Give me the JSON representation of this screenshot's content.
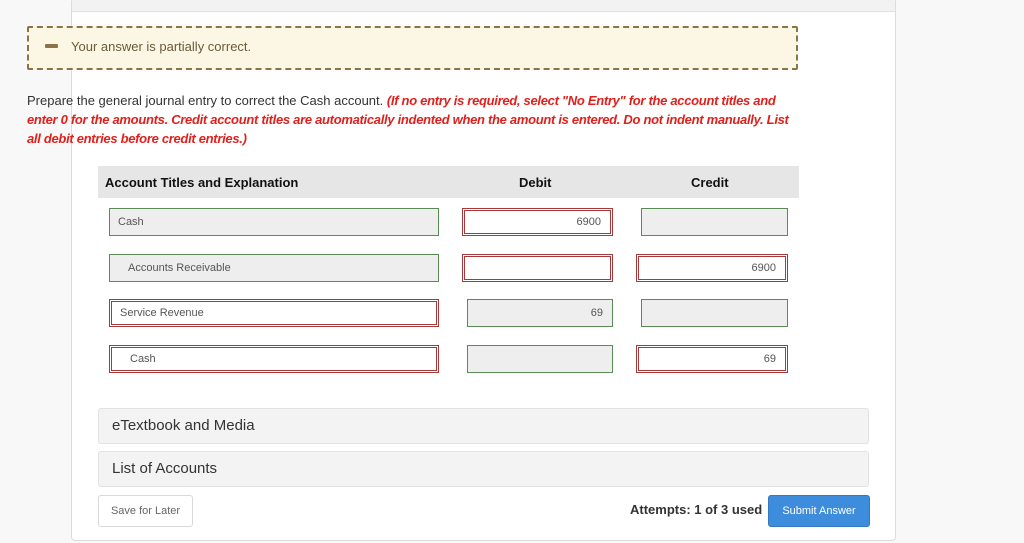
{
  "feedback": {
    "status_icon": "partial-dash-icon",
    "message": "Your answer is partially correct."
  },
  "prompt": {
    "text": "Prepare the general journal entry to correct the Cash account. ",
    "instructions": "(If no entry is required, select \"No Entry\" for the account titles and enter 0 for the amounts. Credit account titles are automatically indented when the amount is entered. Do not indent manually. List all debit entries before credit entries.)"
  },
  "table": {
    "headers": {
      "account": "Account Titles and Explanation",
      "debit": "Debit",
      "credit": "Credit"
    },
    "rows": [
      {
        "account": "Cash",
        "account_status": "correct",
        "debit": "6900",
        "debit_status": "incorrect",
        "credit": "",
        "credit_status": "correct"
      },
      {
        "account": "Accounts Receivable",
        "account_status": "correct",
        "debit": "",
        "debit_status": "incorrect",
        "credit": "6900",
        "credit_status": "incorrect"
      },
      {
        "account": "Service Revenue",
        "account_status": "incorrect",
        "debit": "69",
        "debit_status": "correct",
        "credit": "",
        "credit_status": "correct"
      },
      {
        "account": "Cash",
        "account_status": "incorrect",
        "debit": "",
        "debit_status": "correct",
        "credit": "69",
        "credit_status": "incorrect"
      }
    ]
  },
  "accordions": {
    "etextbook": "eTextbook and Media",
    "list_of_accounts": "List of Accounts"
  },
  "footer": {
    "save_label": "Save for Later",
    "attempts": "Attempts: 1 of 3 used",
    "submit_label": "Submit Answer"
  },
  "colors": {
    "correct_border": "#5a8a55",
    "incorrect_border": "#a63a3a",
    "instruction_red": "#e0201c",
    "submit_blue": "#3e8ddd",
    "feedback_bg": "#fbf7e4"
  }
}
